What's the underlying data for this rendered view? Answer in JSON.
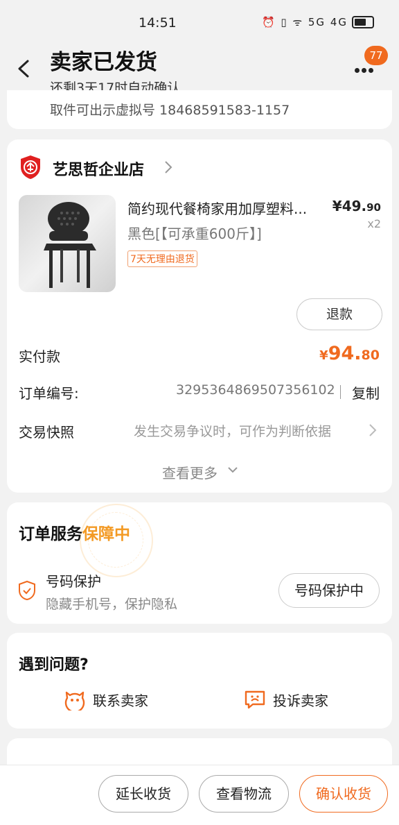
{
  "status_bar": {
    "time": "14:51",
    "icons_text": "⏰ ▯ ᯤ 5G 4G"
  },
  "header": {
    "title": "卖家已发货",
    "subtitle": "还剩3天17时自动确认",
    "badge_count": "77"
  },
  "pickup": {
    "text": "取件可出示虚拟号 18468591583-1157"
  },
  "order": {
    "shop_name": "艺思哲企业店",
    "product": {
      "title": "简约现代餐椅家用加厚塑料...",
      "price_symbol": "¥",
      "price_int": "49.",
      "price_dec": "90",
      "qty": "x2",
      "spec": "黑色[【可承重600斤】]",
      "return_tag": "7天无理由退货"
    },
    "refund_label": "退款",
    "paid": {
      "label": "实付款",
      "symbol": "¥",
      "int": "94.",
      "dec": "80"
    },
    "order_no": {
      "label": "订单编号:",
      "value": "3295364869507356102",
      "copy_label": "复制"
    },
    "snapshot": {
      "label": "交易快照",
      "desc": "发生交易争议时，可作为判断依据"
    },
    "see_more": "查看更多"
  },
  "service": {
    "title_main": "订单服务",
    "title_highlight": "保障中",
    "protect_title": "号码保护",
    "protect_desc": "隐藏手机号，保护隐私",
    "protect_button": "号码保护中"
  },
  "issue": {
    "title": "遇到问题?",
    "contact_label": "联系卖家",
    "complain_label": "投诉卖家"
  },
  "bottom": {
    "extend_label": "延长收货",
    "logistics_label": "查看物流",
    "confirm_label": "确认收货"
  },
  "colors": {
    "accent": "#f06a1f",
    "highlight": "#f39a24"
  },
  "icons": [
    "back-icon",
    "more-icon",
    "shop-shield-icon",
    "chevron-right-icon",
    "chevron-down-icon",
    "shield-check-icon",
    "chat-face-icon",
    "complaint-icon"
  ]
}
